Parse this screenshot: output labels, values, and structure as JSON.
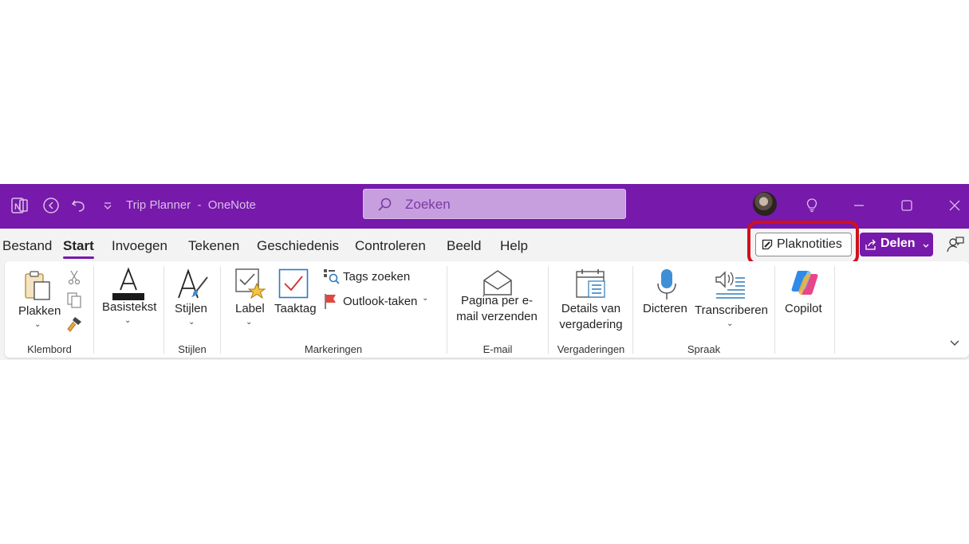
{
  "window": {
    "title": "Trip Planner  -  OneNote",
    "search_placeholder": "Zoeken"
  },
  "tabs": [
    {
      "label": "Bestand",
      "active": false
    },
    {
      "label": "Start",
      "active": true
    },
    {
      "label": "Invoegen",
      "active": false
    },
    {
      "label": "Tekenen",
      "active": false
    },
    {
      "label": "Geschiedenis",
      "active": false
    },
    {
      "label": "Controleren",
      "active": false
    },
    {
      "label": "Beeld",
      "active": false
    },
    {
      "label": "Help",
      "active": false
    }
  ],
  "right_actions": {
    "sticky_notes": "Plaknotities",
    "share": "Delen"
  },
  "ribbon": {
    "clipboard": {
      "paste": "Plakken",
      "group": "Klembord"
    },
    "basic_text": {
      "label": "Basistekst"
    },
    "styles": {
      "label": "Stijlen",
      "group": "Stijlen"
    },
    "tags": {
      "label": "Label",
      "todo": "Taaktag",
      "find_tags": "Tags zoeken",
      "outlook_tasks": "Outlook-taken",
      "group": "Markeringen"
    },
    "email": {
      "line1": "Pagina per e-",
      "line2": "mail verzenden",
      "group": "E-mail"
    },
    "meetings": {
      "line1": "Details van",
      "line2": "vergadering",
      "group": "Vergaderingen"
    },
    "voice": {
      "dictate": "Dicteren",
      "transcribe": "Transcriberen",
      "group": "Spraak"
    },
    "copilot": {
      "label": "Copilot"
    }
  },
  "colors": {
    "accent": "#7719aa",
    "highlight": "#d0101b"
  }
}
